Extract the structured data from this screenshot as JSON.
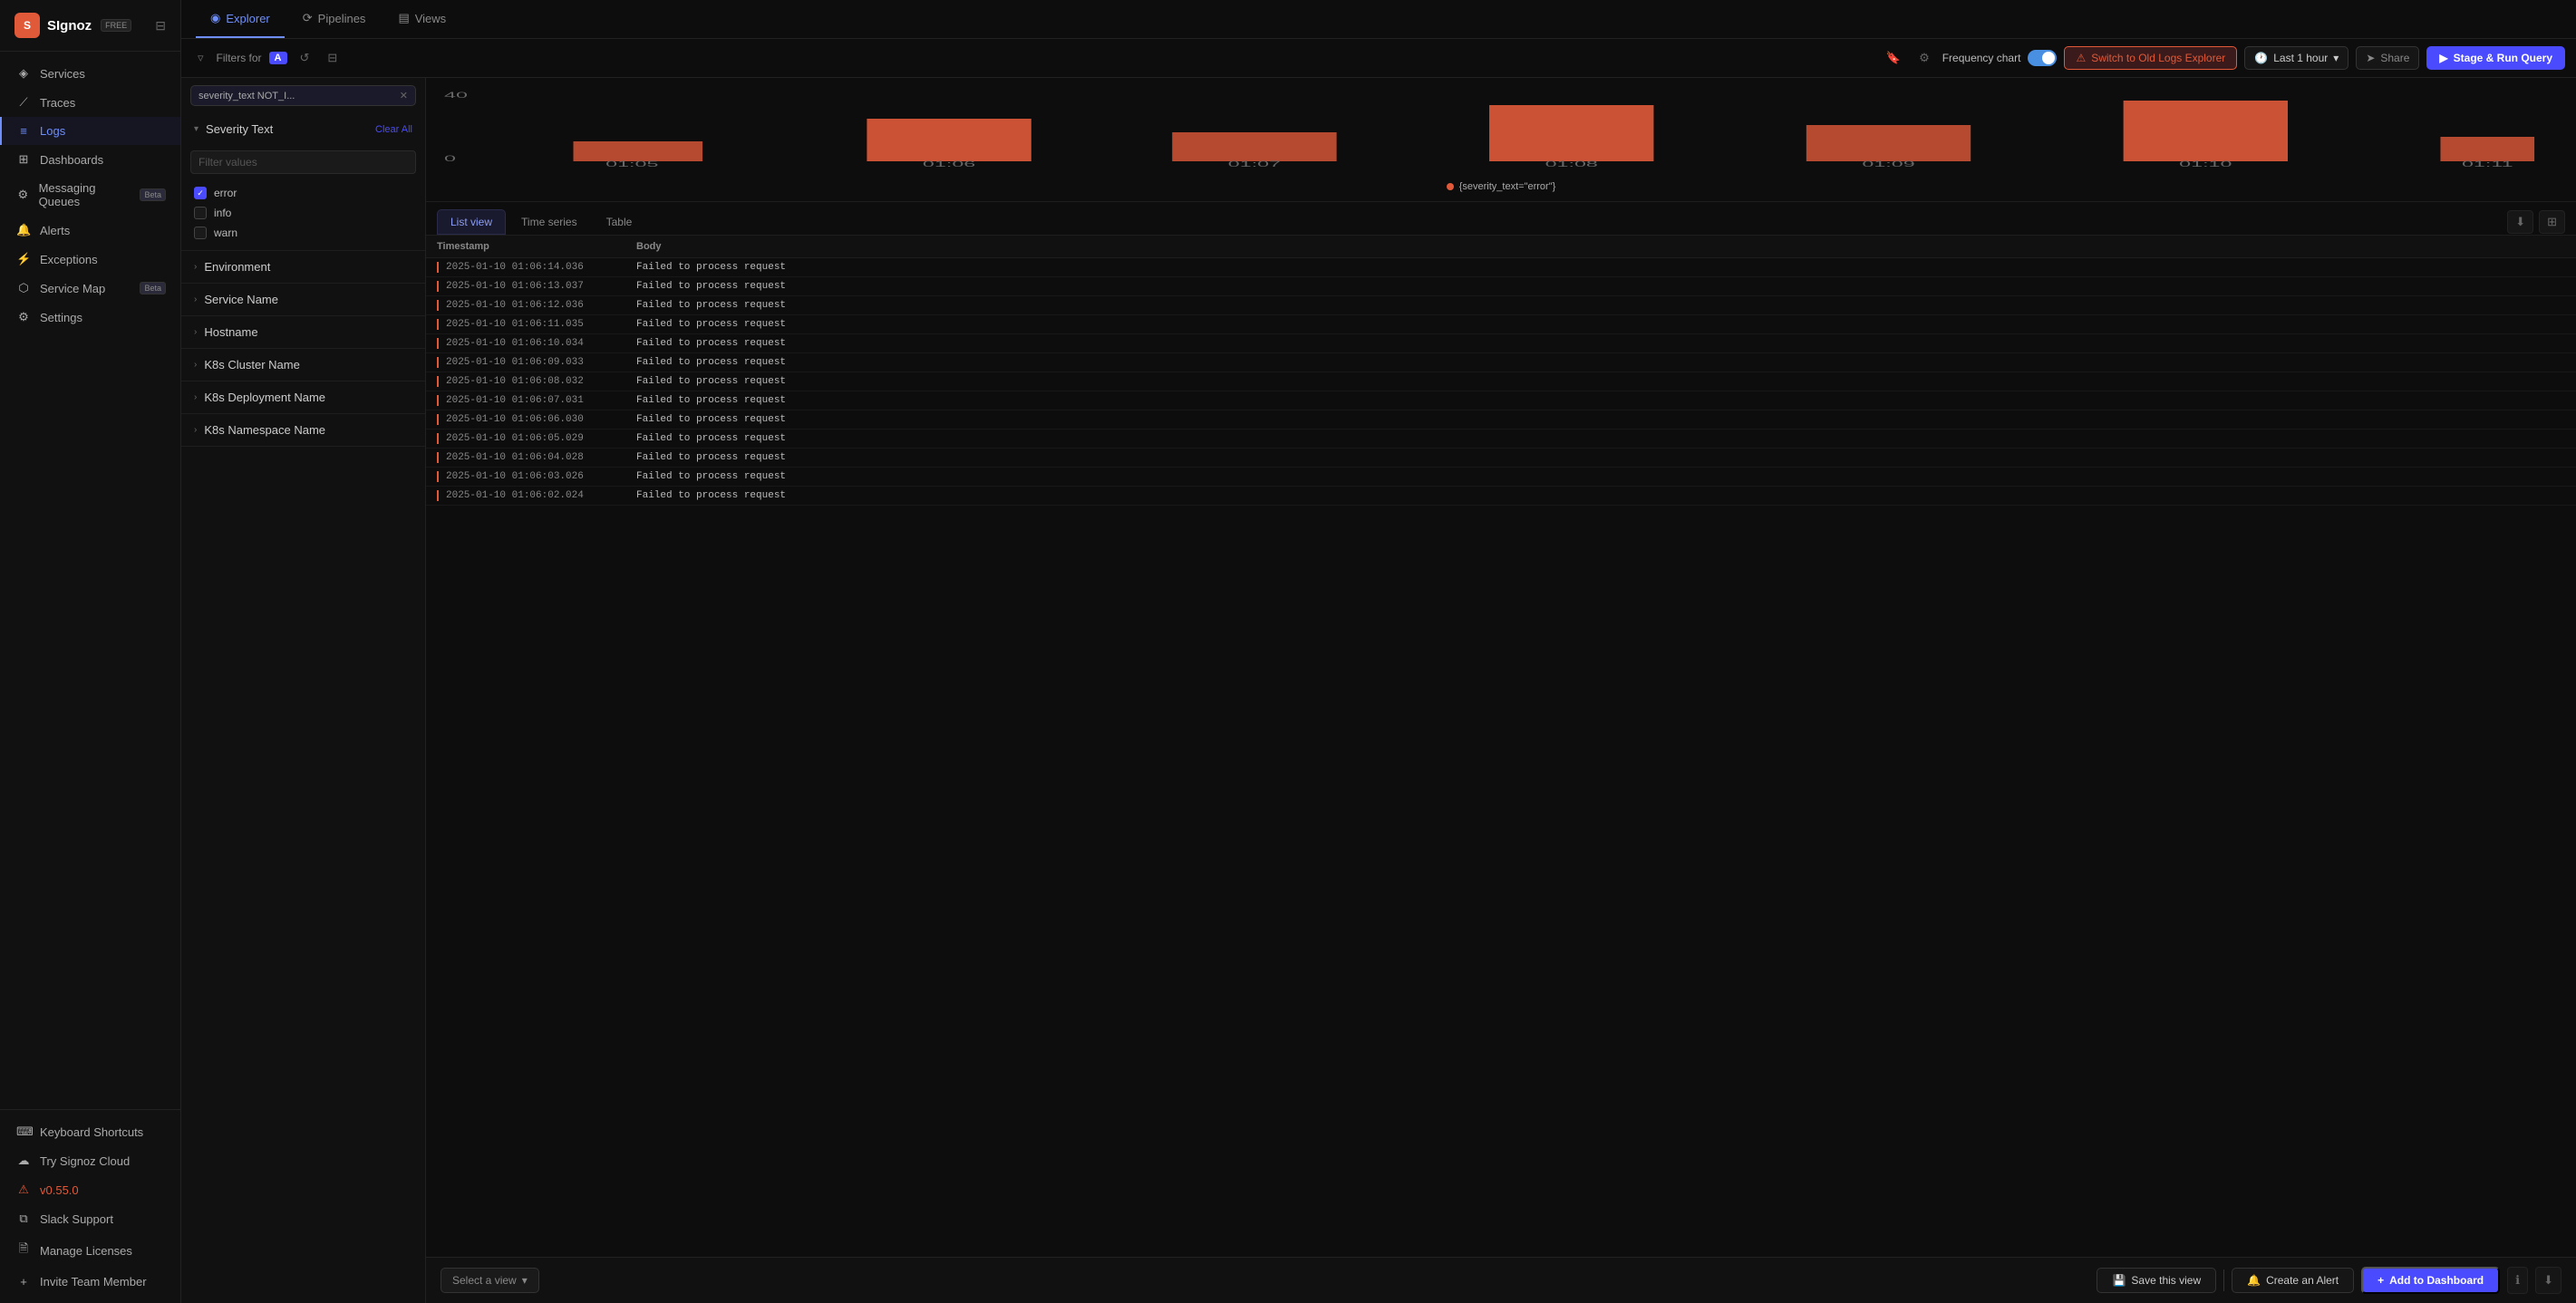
{
  "app": {
    "title": "SIgnoz",
    "logo_letter": "S",
    "badge": "FREE"
  },
  "sidebar": {
    "nav_items": [
      {
        "id": "services",
        "label": "Services",
        "icon": "◈",
        "active": false
      },
      {
        "id": "traces",
        "label": "Traces",
        "icon": "⟋",
        "active": false
      },
      {
        "id": "logs",
        "label": "Logs",
        "icon": "≡",
        "active": true
      },
      {
        "id": "dashboards",
        "label": "Dashboards",
        "icon": "⊞",
        "active": false
      },
      {
        "id": "messaging-queues",
        "label": "Messaging Queues",
        "icon": "⚙",
        "active": false,
        "badge": "Beta"
      },
      {
        "id": "alerts",
        "label": "Alerts",
        "icon": "🔔",
        "active": false
      },
      {
        "id": "exceptions",
        "label": "Exceptions",
        "icon": "⚡",
        "active": false
      },
      {
        "id": "service-map",
        "label": "Service Map",
        "icon": "⬡",
        "active": false,
        "badge": "Beta"
      },
      {
        "id": "settings",
        "label": "Settings",
        "icon": "⚙",
        "active": false
      }
    ],
    "bottom_items": [
      {
        "id": "keyboard-shortcuts",
        "label": "Keyboard Shortcuts",
        "icon": "⌨"
      },
      {
        "id": "try-cloud",
        "label": "Try Signoz Cloud",
        "icon": "☁"
      },
      {
        "id": "version",
        "label": "v0.55.0",
        "icon": "⚠"
      },
      {
        "id": "slack-support",
        "label": "Slack Support",
        "icon": "⧉"
      },
      {
        "id": "manage-licenses",
        "label": "Manage Licenses",
        "icon": "🗎"
      },
      {
        "id": "invite-team",
        "label": "Invite Team Member",
        "icon": "+"
      }
    ]
  },
  "top_tabs": [
    {
      "id": "explorer",
      "label": "Explorer",
      "icon": "◉",
      "active": true
    },
    {
      "id": "pipelines",
      "label": "Pipelines",
      "icon": "⟳",
      "active": false
    },
    {
      "id": "views",
      "label": "Views",
      "icon": "▤",
      "active": false
    }
  ],
  "filter_bar": {
    "filters_label": "Filters for",
    "filter_badge": "A",
    "frequency_chart_label": "Frequency chart",
    "switch_old_label": "Switch to Old Logs Explorer",
    "time_label": "Last 1 hour",
    "share_label": "Share",
    "run_query_label": "Stage & Run Query"
  },
  "active_filter": {
    "label": "severity_text NOT_I...",
    "value": "severity_text NOT_I..."
  },
  "filter_sections": {
    "severity_text": {
      "title": "Severity Text",
      "clear_all": "Clear All",
      "placeholder": "Filter values",
      "options": [
        {
          "id": "error",
          "label": "error",
          "checked": true
        },
        {
          "id": "info",
          "label": "info",
          "checked": false
        },
        {
          "id": "warn",
          "label": "warn",
          "checked": false
        }
      ]
    },
    "environment": {
      "title": "Environment",
      "expanded": false
    },
    "service_name": {
      "title": "Service Name",
      "expanded": false
    },
    "hostname": {
      "title": "Hostname",
      "expanded": false
    },
    "k8s_cluster": {
      "title": "K8s Cluster Name",
      "expanded": false
    },
    "k8s_deployment": {
      "title": "K8s Deployment Name",
      "expanded": false
    },
    "k8s_namespace": {
      "title": "K8s Namespace Name",
      "expanded": false
    }
  },
  "chart": {
    "y_max": 40,
    "y_min": 0,
    "time_labels": [
      "01:05",
      "01:06",
      "01:07",
      "01:08",
      "01:09",
      "01:10",
      "01:11"
    ],
    "legend": "{severity_text=\"error\"}"
  },
  "view_tabs": [
    {
      "id": "list-view",
      "label": "List view",
      "active": true
    },
    {
      "id": "time-series",
      "label": "Time series",
      "active": false
    },
    {
      "id": "table",
      "label": "Table",
      "active": false
    }
  ],
  "logs_table": {
    "columns": [
      "Timestamp",
      "Body"
    ],
    "rows": [
      {
        "timestamp": "2025-01-10 01:06:14.036",
        "body": "Failed to process request"
      },
      {
        "timestamp": "2025-01-10 01:06:13.037",
        "body": "Failed to process request"
      },
      {
        "timestamp": "2025-01-10 01:06:12.036",
        "body": "Failed to process request"
      },
      {
        "timestamp": "2025-01-10 01:06:11.035",
        "body": "Failed to process request"
      },
      {
        "timestamp": "2025-01-10 01:06:10.034",
        "body": "Failed to process request"
      },
      {
        "timestamp": "2025-01-10 01:06:09.033",
        "body": "Failed to process request"
      },
      {
        "timestamp": "2025-01-10 01:06:08.032",
        "body": "Failed to process request"
      },
      {
        "timestamp": "2025-01-10 01:06:07.031",
        "body": "Failed to process request"
      },
      {
        "timestamp": "2025-01-10 01:06:06.030",
        "body": "Failed to process request"
      },
      {
        "timestamp": "2025-01-10 01:06:05.029",
        "body": "Failed to process request"
      },
      {
        "timestamp": "2025-01-10 01:06:04.028",
        "body": "Failed to process request"
      },
      {
        "timestamp": "2025-01-10 01:06:03.026",
        "body": "Failed to process request"
      },
      {
        "timestamp": "2025-01-10 01:06:02.024",
        "body": "Failed to process request"
      }
    ]
  },
  "bottom_bar": {
    "select_view_label": "Select a view",
    "save_view_label": "Save this view",
    "create_alert_label": "Create an Alert",
    "add_dashboard_label": "Add to Dashboard"
  }
}
